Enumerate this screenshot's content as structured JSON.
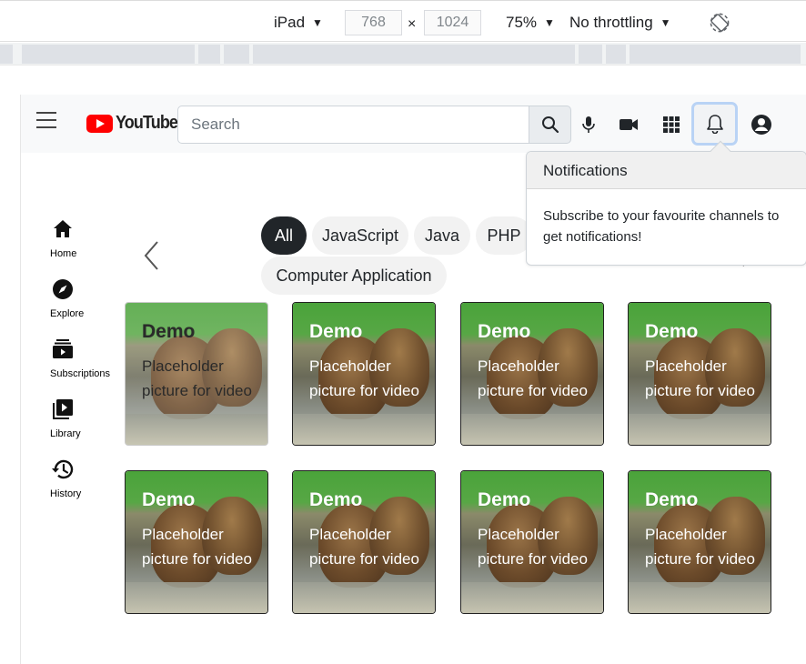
{
  "devtools": {
    "device": "iPad",
    "width": "768",
    "times": "×",
    "height": "1024",
    "zoom": "75%",
    "throttling": "No throttling"
  },
  "header": {
    "logo_text": "YouTube",
    "search_placeholder": "Search"
  },
  "sidebar": {
    "items": [
      {
        "label": "Home",
        "icon": "home-icon"
      },
      {
        "label": "Explore",
        "icon": "compass-icon"
      },
      {
        "label": "Subscriptions",
        "icon": "subscriptions-icon"
      },
      {
        "label": "Library",
        "icon": "library-icon"
      },
      {
        "label": "History",
        "icon": "history-icon"
      }
    ]
  },
  "chips": [
    "All",
    "JavaScript",
    "Java",
    "PHP",
    "Computer Application"
  ],
  "notifications": {
    "title": "Notifications",
    "body": "Subscribe to your favourite channels to get notifications!"
  },
  "cards": [
    {
      "title": "Demo",
      "subtitle": "Placeholder picture for video"
    },
    {
      "title": "Demo",
      "subtitle": "Placeholder picture for video"
    },
    {
      "title": "Demo",
      "subtitle": "Placeholder picture for video"
    },
    {
      "title": "Demo",
      "subtitle": "Placeholder picture for video"
    },
    {
      "title": "Demo",
      "subtitle": "Placeholder picture for video"
    },
    {
      "title": "Demo",
      "subtitle": "Placeholder picture for video"
    },
    {
      "title": "Demo",
      "subtitle": "Placeholder picture for video"
    },
    {
      "title": "Demo",
      "subtitle": "Placeholder picture for video"
    }
  ],
  "colors": {
    "brand_red": "#ff0000",
    "chip_active": "#212529",
    "chip_bg": "#f2f2f2",
    "bell_focus": "#b9d3f5"
  }
}
